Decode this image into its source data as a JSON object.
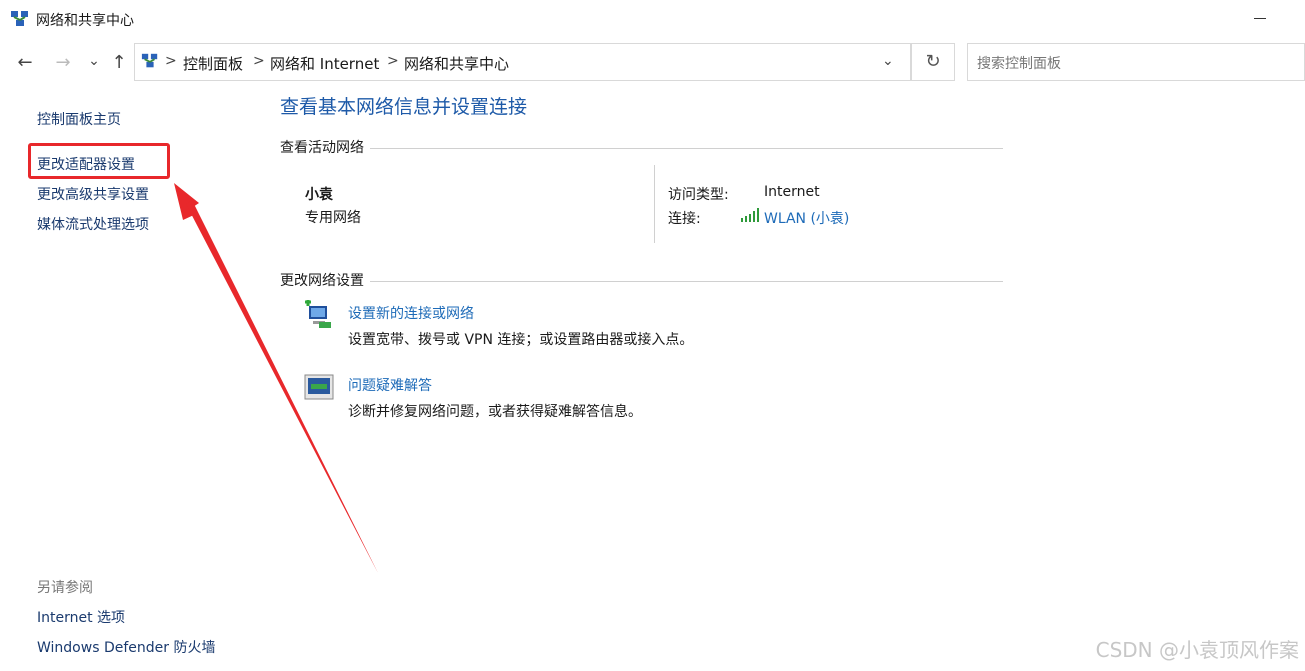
{
  "window": {
    "title": "网络和共享中心",
    "minimize_icon": "minimize-icon"
  },
  "nav": {
    "back_icon": "←",
    "forward_icon": "→",
    "recent_icon": "⌄",
    "up_icon": "↑"
  },
  "address": {
    "breadcrumbs": [
      "控制面板",
      "网络和 Internet",
      "网络和共享中心"
    ],
    "separator": ">",
    "dropdown_icon": "⌄",
    "refresh_icon": "↻"
  },
  "search": {
    "placeholder": "搜索控制面板"
  },
  "sidebar": {
    "items": [
      {
        "label": "控制面板主页"
      },
      {
        "label": "更改适配器设置"
      },
      {
        "label": "更改高级共享设置"
      },
      {
        "label": "媒体流式处理选项"
      }
    ],
    "see_also_title": "另请参阅",
    "see_also": [
      {
        "label": "Internet 选项"
      },
      {
        "label": "Windows Defender 防火墙"
      }
    ]
  },
  "main": {
    "title": "查看基本网络信息并设置连接",
    "active_networks_heading": "查看活动网络",
    "network": {
      "name": "小袁",
      "type": "专用网络",
      "access_type_label": "访问类型:",
      "access_type_value": "Internet",
      "connection_label": "连接:",
      "connection_value": "WLAN (小袁)"
    },
    "change_settings_heading": "更改网络设置",
    "tasks": [
      {
        "link": "设置新的连接或网络",
        "desc": "设置宽带、拨号或 VPN 连接；或设置路由器或接入点。",
        "icon": "new-connection-icon"
      },
      {
        "link": "问题疑难解答",
        "desc": "诊断并修复网络问题，或者获得疑难解答信息。",
        "icon": "troubleshoot-icon"
      }
    ]
  },
  "watermark": "CSDN @小袁顶风作案",
  "colors": {
    "link": "#1e6bb8",
    "title": "#1e5aa8",
    "highlight": "#e8282b"
  }
}
